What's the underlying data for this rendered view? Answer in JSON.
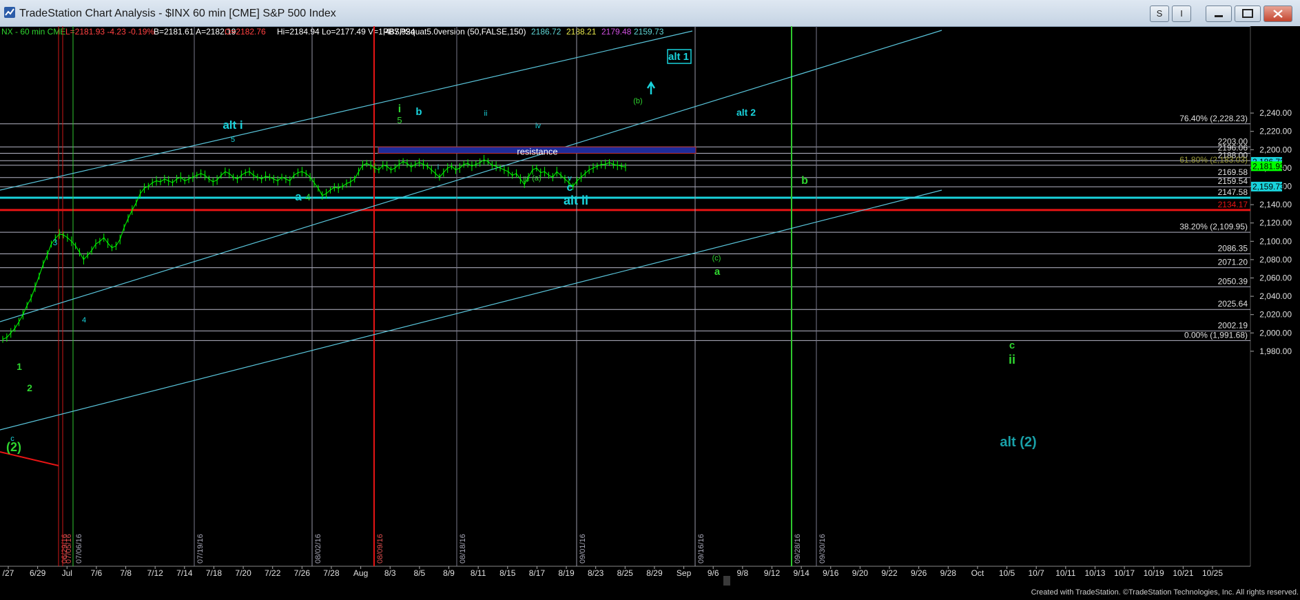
{
  "window": {
    "title": "TradeStation Chart Analysis - $INX 60 min [CME] S&P 500 Index",
    "buttons": [
      "S",
      "I"
    ]
  },
  "footer": "Created with TradeStation. ©TradeStation Technologies, Inc. All rights reserved.",
  "colors": {
    "background": "#000000",
    "price": "#00ff00",
    "cyan": "#19d3dc",
    "channel": "#5ac6dc",
    "red": "#e81414",
    "green_line": "#2fc82f",
    "resistance_fill": "#1e2c9a"
  },
  "chart_data": {
    "type": "line",
    "title": "",
    "info_bar": [
      {
        "text": "NX - 60 min  CME",
        "color": "#2fd52f"
      },
      {
        "text": "L=2181.93  -4.23  -0.19%",
        "color": "#ff4040"
      },
      {
        "text": "B=2181.61  A=2182.19",
        "color": "#ffffff"
      },
      {
        "text": "O=2182.76",
        "color": "#ff4040"
      },
      {
        "text": "Hi=2184.94  Lo=2177.49  V=1,487,924",
        "color": "#ffffff"
      },
      {
        "text": "PBSPSquat5.0version (50,FALSE,150)",
        "color": "#ffffff"
      },
      {
        "text": "2186.72",
        "color": "#5fd6d6"
      },
      {
        "text": "2188.21",
        "color": "#e6e64a"
      },
      {
        "text": "2179.48",
        "color": "#d050e0"
      },
      {
        "text": "2159.73",
        "color": "#5fd6d6"
      }
    ],
    "ylim": [
      1970,
      2250
    ],
    "y_ticks": [
      "2,240.00",
      "2,220.00",
      "2,200.00",
      "2,180.00",
      "2,160.00",
      "2,140.00",
      "2,120.00",
      "2,100.00",
      "2,080.00",
      "2,060.00",
      "2,040.00",
      "2,020.00",
      "2,000.00",
      "1,980.00"
    ],
    "x_ticks": [
      "/27",
      "6/29",
      "Jul",
      "7/6",
      "7/8",
      "7/12",
      "7/14",
      "7/18",
      "7/20",
      "7/22",
      "7/26",
      "7/28",
      "Aug",
      "8/3",
      "8/5",
      "8/9",
      "8/11",
      "8/15",
      "8/17",
      "8/19",
      "8/23",
      "8/25",
      "8/29",
      "Sep",
      "9/6",
      "9/8",
      "9/12",
      "9/14",
      "9/16",
      "9/20",
      "9/22",
      "9/26",
      "9/28",
      "Oct",
      "10/5",
      "10/7",
      "10/11",
      "10/13",
      "10/17",
      "10/19",
      "10/21",
      "10/25"
    ],
    "horizontal_levels": [
      {
        "price": 2228.23,
        "label": "76.40% (2,228.23)"
      },
      {
        "price": 2203.0,
        "label": "2203.00"
      },
      {
        "price": 2196.06,
        "label": "2196.06"
      },
      {
        "price": 2188.0,
        "label": "2188.00"
      },
      {
        "price": 2183.03,
        "label": "61.80% (2,183.03)"
      },
      {
        "price": 2169.58,
        "label": "2169.58"
      },
      {
        "price": 2159.54,
        "label": "2159.54"
      },
      {
        "price": 2147.58,
        "label": "2147.58"
      },
      {
        "price": 2134.17,
        "label": "2134.17"
      },
      {
        "price": 2109.95,
        "label": "38.20% (2,109.95)"
      },
      {
        "price": 2086.35,
        "label": "2086.35"
      },
      {
        "price": 2071.2,
        "label": "2071.20"
      },
      {
        "price": 2050.39,
        "label": "2050.39"
      },
      {
        "price": 2025.64,
        "label": "2025.64"
      },
      {
        "price": 2002.19,
        "label": "2002.19"
      },
      {
        "price": 1991.68,
        "label": "0.00% (1,991.68)"
      }
    ],
    "price_badges": [
      {
        "price": 2186.72,
        "label": "2,186.72",
        "color": "#19d3dc"
      },
      {
        "price": 2181.93,
        "label": "2,181.93",
        "color": "#00ff00"
      },
      {
        "price": 2159.73,
        "label": "2,159.73",
        "color": "#19d3dc"
      }
    ],
    "date_markers": [
      "06/29/16",
      "07/05/16",
      "07/06/16",
      "07/19/16",
      "08/02/16",
      "08/09/16",
      "08/18/16",
      "09/01/16",
      "09/16/16",
      "09/28/16",
      "09/30/16"
    ],
    "resistance_label": "resistance",
    "wave_labels": [
      {
        "text": "alt 1",
        "color": "#19d3dc"
      },
      {
        "text": "alt 2",
        "color": "#19d3dc"
      },
      {
        "text": "alt i",
        "color": "#19d3dc"
      },
      {
        "text": "alt ii",
        "color": "#19d3dc"
      },
      {
        "text": "a",
        "color": "#19d3dc"
      },
      {
        "text": "4",
        "color": "#2fd52f"
      },
      {
        "text": "5",
        "color": "#2fd52f"
      },
      {
        "text": "i",
        "color": "#2fd52f"
      },
      {
        "text": "b",
        "color": "#19d3dc"
      },
      {
        "text": "ii",
        "color": "#19d3dc"
      },
      {
        "text": "iv",
        "color": "#19d3dc"
      },
      {
        "text": "iii",
        "color": "#2fd52f"
      },
      {
        "text": "(a)",
        "color": "#2fd52f"
      },
      {
        "text": "v",
        "color": "#19d3dc"
      },
      {
        "text": "c",
        "color": "#19d3dc"
      },
      {
        "text": "i",
        "color": "#19d3dc"
      },
      {
        "text": "(b)",
        "color": "#2fd52f"
      },
      {
        "text": "b",
        "color": "#2fd52f"
      },
      {
        "text": "(c)",
        "color": "#2fd52f"
      },
      {
        "text": "a",
        "color": "#2fd52f"
      },
      {
        "text": "c",
        "color": "#2fd52f"
      },
      {
        "text": "ii",
        "color": "#2fd52f"
      },
      {
        "text": "alt (2)",
        "color": "#19a0a8"
      },
      {
        "text": "3",
        "color": "#19d3dc"
      },
      {
        "text": "4",
        "color": "#19d3dc"
      },
      {
        "text": "1",
        "color": "#2fd52f"
      },
      {
        "text": "2",
        "color": "#2fd52f"
      },
      {
        "text": "c",
        "color": "#19d3dc"
      },
      {
        "text": "(2)",
        "color": "#2fd52f"
      },
      {
        "text": "5",
        "color": "#19d3dc"
      }
    ],
    "series": [
      {
        "values": [
          1993,
          1995,
          2000,
          2005,
          2012,
          2020,
          2030,
          2038,
          2050,
          2062,
          2075,
          2085,
          2097,
          2103,
          2108,
          2107,
          2104,
          2100,
          2095,
          2088,
          2080,
          2085,
          2090,
          2097,
          2100,
          2104,
          2098,
          2093,
          2095,
          2102,
          2115,
          2125,
          2134,
          2142,
          2152,
          2158,
          2160,
          2164,
          2166,
          2165,
          2168,
          2166,
          2164,
          2168,
          2170,
          2166,
          2168,
          2170,
          2172,
          2174,
          2172,
          2168,
          2165,
          2167,
          2172,
          2176,
          2174,
          2170,
          2168,
          2172,
          2175,
          2176,
          2172,
          2170,
          2168,
          2171,
          2170,
          2168,
          2166,
          2170,
          2168,
          2166,
          2172,
          2175,
          2176,
          2174,
          2170,
          2164,
          2158,
          2150,
          2152,
          2156,
          2159,
          2158,
          2160,
          2163,
          2165,
          2168,
          2176,
          2183,
          2185,
          2183,
          2180,
          2178,
          2183,
          2182,
          2178,
          2180,
          2184,
          2187,
          2185,
          2181,
          2184,
          2186,
          2184,
          2182,
          2178,
          2174,
          2170,
          2175,
          2180,
          2182,
          2178,
          2180,
          2184,
          2185,
          2182,
          2184,
          2186,
          2189,
          2187,
          2183,
          2182,
          2180,
          2178,
          2176,
          2172,
          2174,
          2168,
          2162,
          2170,
          2178,
          2180,
          2175,
          2176,
          2172,
          2170,
          2176,
          2172,
          2168,
          2164,
          2160,
          2166,
          2170,
          2174,
          2178,
          2180,
          2182,
          2184,
          2184,
          2186,
          2184,
          2183,
          2182,
          2181
        ]
      }
    ]
  }
}
